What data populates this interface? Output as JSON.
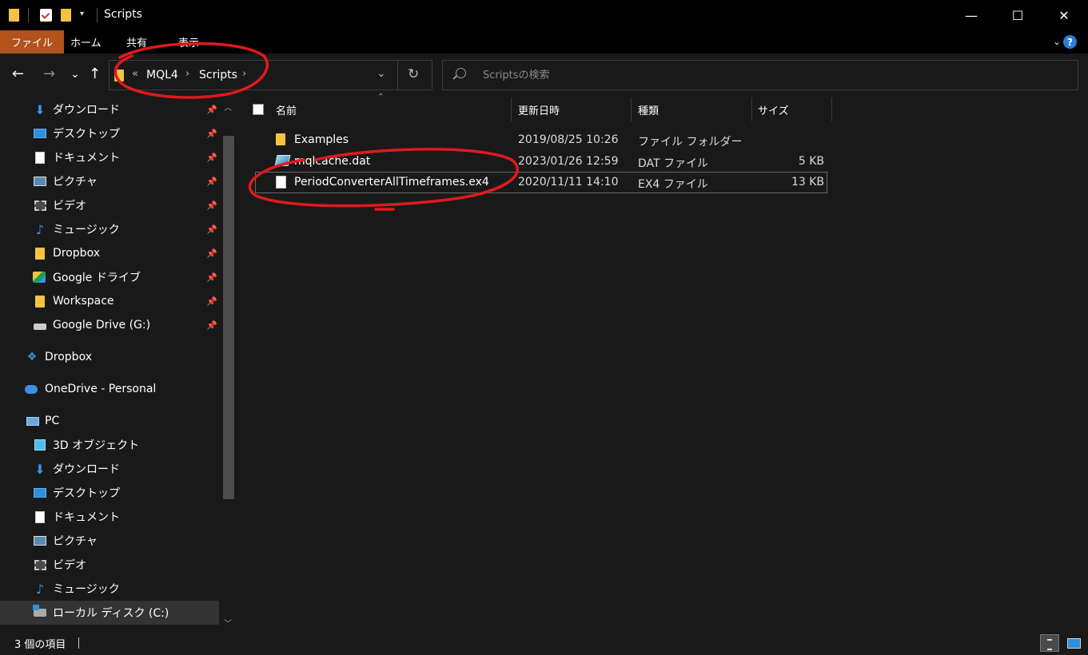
{
  "window": {
    "title": "Scripts",
    "minimize_glyph": "—",
    "maximize_glyph": "☐",
    "close_glyph": "✕"
  },
  "quick_access_toolbar": {
    "dropdown_glyph": "▾"
  },
  "ribbon": {
    "tabs": [
      "ファイル",
      "ホーム",
      "共有",
      "表示"
    ],
    "expand_glyph": "⌄",
    "help_glyph": "?"
  },
  "navigation": {
    "back_glyph": "←",
    "forward_glyph": "→",
    "recent_glyph": "⌄",
    "up_glyph": "↑"
  },
  "address_bar": {
    "overflow_glyph": "«",
    "segments": [
      "MQL4",
      "Scripts"
    ],
    "separator_glyph": "›",
    "dropdown_glyph": "⌄",
    "refresh_glyph": "↻"
  },
  "search": {
    "placeholder": "Scriptsの検索"
  },
  "nav_pane": {
    "quick_access": [
      {
        "label": "ダウンロード",
        "icon": "download-icon"
      },
      {
        "label": "デスクトップ",
        "icon": "desktop-icon"
      },
      {
        "label": "ドキュメント",
        "icon": "document-icon"
      },
      {
        "label": "ピクチャ",
        "icon": "pictures-icon"
      },
      {
        "label": "ビデオ",
        "icon": "video-icon"
      },
      {
        "label": "ミュージック",
        "icon": "music-icon"
      },
      {
        "label": "Dropbox",
        "icon": "folder-icon"
      },
      {
        "label": "Google ドライブ",
        "icon": "google-drive-icon"
      },
      {
        "label": "Workspace",
        "icon": "folder-icon"
      },
      {
        "label": "Google Drive (G:)",
        "icon": "drive-icon"
      }
    ],
    "dropbox": "Dropbox",
    "onedrive": "OneDrive - Personal",
    "pc": "PC",
    "pc_items": [
      {
        "label": "3D オブジェクト",
        "icon": "3d-objects-icon"
      },
      {
        "label": "ダウンロード",
        "icon": "download-icon"
      },
      {
        "label": "デスクトップ",
        "icon": "desktop-icon"
      },
      {
        "label": "ドキュメント",
        "icon": "document-icon"
      },
      {
        "label": "ピクチャ",
        "icon": "pictures-icon"
      },
      {
        "label": "ビデオ",
        "icon": "video-icon"
      },
      {
        "label": "ミュージック",
        "icon": "music-icon"
      },
      {
        "label": "ローカル ディスク (C:)",
        "icon": "local-disk-icon"
      }
    ],
    "selected": "ローカル ディスク (C:)",
    "pin_glyph": "📌"
  },
  "file_list": {
    "columns": {
      "name": "名前",
      "modified": "更新日時",
      "type": "種類",
      "size": "サイズ"
    },
    "sort_glyph": "⌃",
    "rows": [
      {
        "name": "Examples",
        "modified": "2019/08/25 10:26",
        "type": "ファイル フォルダー",
        "size": "",
        "icon": "folder-icon"
      },
      {
        "name": "mqlcache.dat",
        "modified": "2023/01/26 12:59",
        "type": "DAT ファイル",
        "size": "5 KB",
        "icon": "dat-file-icon"
      },
      {
        "name": "PeriodConverterAllTimeframes.ex4",
        "modified": "2020/11/11 14:10",
        "type": "EX4 ファイル",
        "size": "13 KB",
        "icon": "file-icon"
      }
    ]
  },
  "status_bar": {
    "item_count": "3 個の項目"
  },
  "colors": {
    "active_tab": "#b3521b",
    "annotation": "#e0191d",
    "background": "#191919"
  }
}
